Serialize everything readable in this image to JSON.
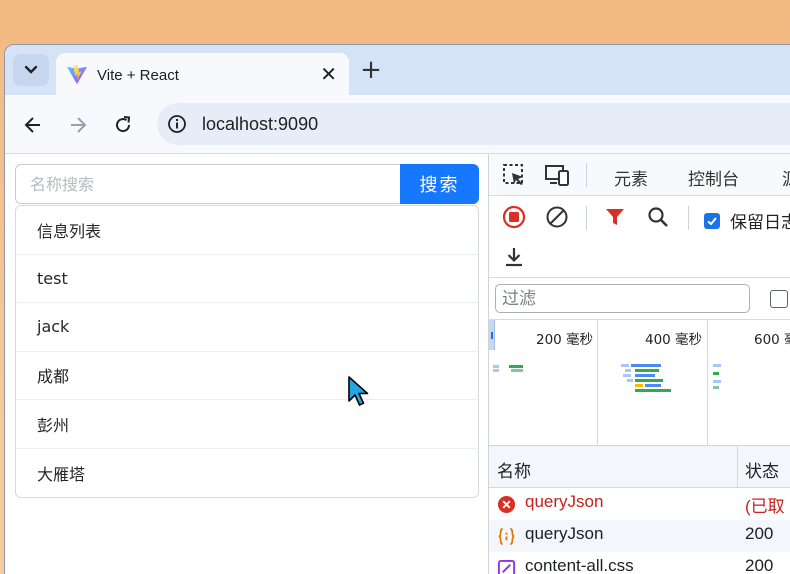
{
  "browser": {
    "tab": {
      "title": "Vite + React",
      "close": "✕"
    },
    "new_tab": "+",
    "address": "localhost:9090"
  },
  "page": {
    "search": {
      "placeholder": "名称搜索",
      "button_label": "搜索"
    },
    "results": [
      "信息列表",
      "test",
      "jack",
      "成都",
      "彭州",
      "大雁塔"
    ]
  },
  "devtools": {
    "tabs": [
      "元素",
      "控制台",
      "源"
    ],
    "preserve_log_label": "保留日志",
    "preserve_log_checked": true,
    "filter_placeholder": "过滤",
    "timeline_labels": [
      "200 毫秒",
      "400 毫秒",
      "600 毫"
    ],
    "columns": {
      "name": "名称",
      "status": "状态"
    },
    "requests": [
      {
        "name": "queryJson",
        "status": "(已取",
        "icon": "error-icon",
        "color": "#c5221f"
      },
      {
        "name": "queryJson",
        "status": "200",
        "icon": "json-icon",
        "color": "#202124"
      },
      {
        "name": "content-all.css",
        "status": "200",
        "icon": "css-icon",
        "color": "#202124"
      }
    ]
  },
  "colors": {
    "accent": "#1677ff",
    "devtools_blue": "#1a73e8",
    "record_red": "#d93025",
    "error_red": "#c5221f"
  }
}
